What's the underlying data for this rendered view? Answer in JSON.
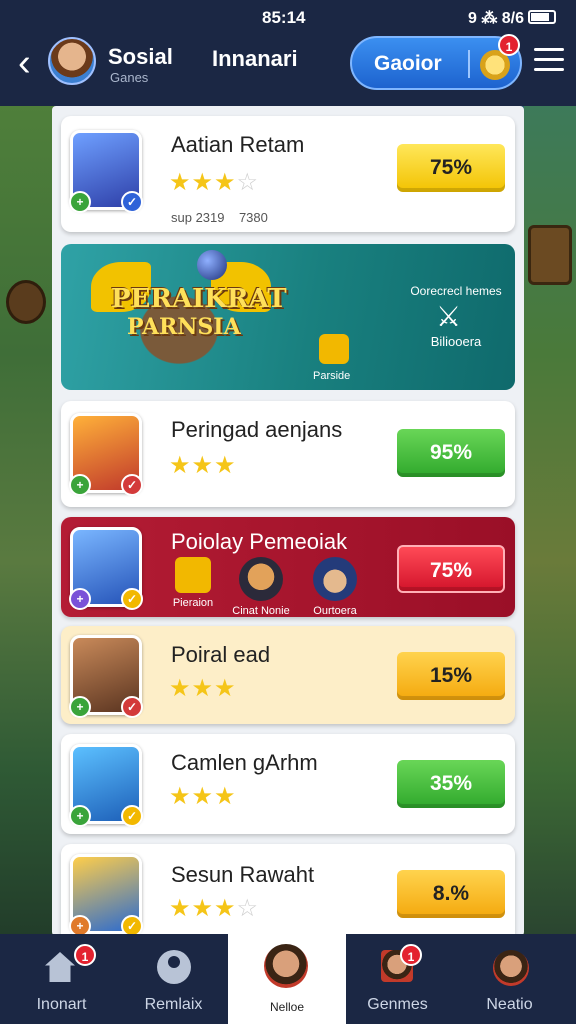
{
  "status": {
    "time": "85:14",
    "indicators": "9 ⁂ 8/6"
  },
  "header": {
    "back_icon": "chevron-left-icon",
    "app_title": "Sosial",
    "app_subtitle": "Ganes",
    "page_title": "Innanari",
    "pill_label": "Gaoior",
    "pill_badge": "1",
    "menu_icon": "hamburger-icon"
  },
  "games": [
    {
      "name": "Aatian Retam",
      "rating": 3.5,
      "meta": "sup 2319    7380",
      "percent": "75%",
      "badge_color": "yellow"
    },
    {
      "name": "Peringad aenjans",
      "rating": 3,
      "percent": "95%",
      "badge_color": "green"
    },
    {
      "name": "Poiolay Pemeoiak",
      "percent": "75%",
      "badge_color": "red",
      "featured": [
        {
          "label": "Pieraion"
        },
        {
          "label": "Cinat Nonie"
        },
        {
          "label": "Ourtoera"
        }
      ]
    },
    {
      "name": "Poiral ead",
      "rating": 3,
      "percent": "15%",
      "badge_color": "orange"
    },
    {
      "name": "Camlen gArhm",
      "rating": 3,
      "percent": "35%",
      "badge_color": "green"
    },
    {
      "name": "Sesun Rawaht",
      "rating": 3.5,
      "percent": "8.%",
      "badge_color": "orange"
    }
  ],
  "banner": {
    "logo_line1": "PERAIKRAT",
    "logo_line2": "PARNSIA",
    "gift_label": "Parside",
    "side_title": "Oorecrecl hemes",
    "side_label": "Biliooera"
  },
  "tabs": [
    {
      "label": "Inonart",
      "badge": "1",
      "icon": "home-icon"
    },
    {
      "label": "Remlaix",
      "icon": "profile-icon"
    },
    {
      "label": "Nelloe",
      "icon": "avatar-icon",
      "active": true
    },
    {
      "label": "Genmes",
      "badge": "1",
      "icon": "games-icon"
    },
    {
      "label": "Neatio",
      "icon": "friend-icon"
    }
  ],
  "colors": {
    "navy": "#1b2744",
    "accent_blue": "#2f7be6",
    "red_card": "#b41c34",
    "star": "#f5c518"
  }
}
